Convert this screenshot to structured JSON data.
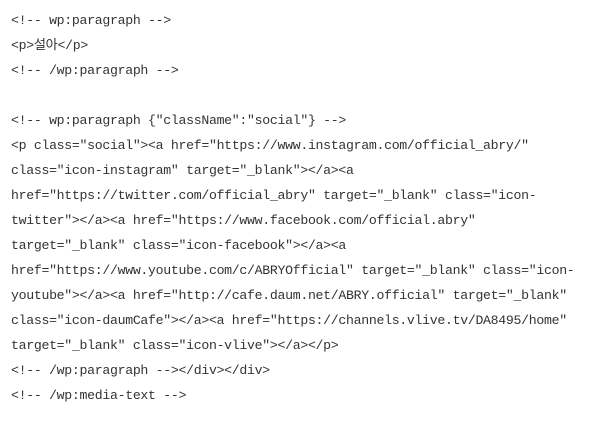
{
  "code_view": {
    "lines": [
      "<!-- wp:paragraph -->",
      "<p>설아</p>",
      "<!-- /wp:paragraph -->",
      "",
      "<!-- wp:paragraph {\"className\":\"social\"} -->",
      "<p class=\"social\"><a href=\"https://www.instagram.com/official_abry/\"",
      "class=\"icon-instagram\" target=\"_blank\"></a><a",
      "href=\"https://twitter.com/official_abry\" target=\"_blank\" class=\"icon-",
      "twitter\"></a><a href=\"https://www.facebook.com/official.abry\"",
      "target=\"_blank\" class=\"icon-facebook\"></a><a",
      "href=\"https://www.youtube.com/c/ABRYOfficial\" target=\"_blank\" class=\"icon-",
      "youtube\"></a><a href=\"http://cafe.daum.net/ABRY.official\" target=\"_blank\"",
      "class=\"icon-daumCafe\"></a><a href=\"https://channels.vlive.tv/DA8495/home\"",
      "target=\"_blank\" class=\"icon-vlive\"></a></p>",
      "<!-- /wp:paragraph --></div></div>",
      "<!-- /wp:media-text -->"
    ]
  }
}
